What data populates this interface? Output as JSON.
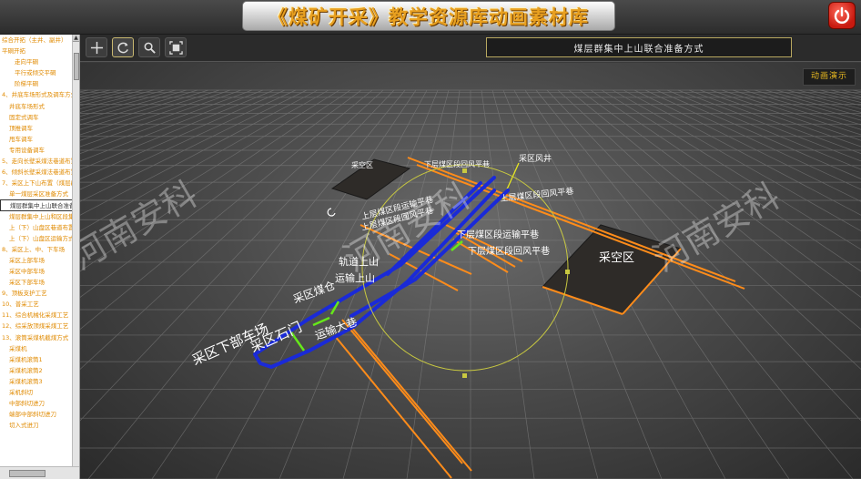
{
  "header": {
    "title": "《煤矿开采》教学资源库动画素材库"
  },
  "sidebar": {
    "items": [
      {
        "label": "综合开拓（主井、副井）",
        "level": 1
      },
      {
        "label": "平硐开拓",
        "level": 1
      },
      {
        "label": "走向平硐",
        "level": 3
      },
      {
        "label": "平行或倾交平硐",
        "level": 3
      },
      {
        "label": "阶梯平硐",
        "level": 3
      },
      {
        "label": "4、井底车场形式及调车方式",
        "level": 1
      },
      {
        "label": "井底车场形式",
        "level": 2
      },
      {
        "label": "固定式调车",
        "level": 2
      },
      {
        "label": "顶推调车",
        "level": 2
      },
      {
        "label": "甩车调车",
        "level": 2
      },
      {
        "label": "专用设备调车",
        "level": 2
      },
      {
        "label": "5、走向长壁采煤法巷道布置",
        "level": 1
      },
      {
        "label": "6、倾斜长壁采煤法巷道布置",
        "level": 1
      },
      {
        "label": "7、采区上下山布置（煤层群）",
        "level": 1
      },
      {
        "label": "单一煤层采区准备方式",
        "level": 2
      },
      {
        "label": "煤层群集中上山联合准备方式",
        "level": 2,
        "selected": true
      },
      {
        "label": "煤层群集中上山和区段集中平巷",
        "level": 2
      },
      {
        "label": "上（下）山盘区巷道布置",
        "level": 2
      },
      {
        "label": "上（下）山盘区运输方式",
        "level": 2
      },
      {
        "label": "8、采区上、中、下车场",
        "level": 1
      },
      {
        "label": "采区上部车场",
        "level": 2
      },
      {
        "label": "采区中部车场",
        "level": 2
      },
      {
        "label": "采区下部车场",
        "level": 2
      },
      {
        "label": "9、顶板支护工艺",
        "level": 1
      },
      {
        "label": "10、普采工艺",
        "level": 1
      },
      {
        "label": "11、综合机械化采煤工艺",
        "level": 1
      },
      {
        "label": "12、综采放顶煤采煤工艺",
        "level": 1
      },
      {
        "label": "13、滚筒采煤机截煤方式",
        "level": 1
      },
      {
        "label": "采煤机",
        "level": 2
      },
      {
        "label": "采煤机滚筒1",
        "level": 2
      },
      {
        "label": "采煤机滚筒2",
        "level": 2
      },
      {
        "label": "采煤机滚筒3",
        "level": 2
      },
      {
        "label": "采机斜切",
        "level": 2
      },
      {
        "label": "中部斜切进刀",
        "level": 2
      },
      {
        "label": "端部中部斜切进刀",
        "level": 2
      },
      {
        "label": "切入式进刀",
        "level": 2
      }
    ]
  },
  "toolbar": {
    "tools": [
      {
        "name": "move-tool",
        "icon": "crosshair-icon"
      },
      {
        "name": "rotate-tool",
        "icon": "rotate-icon",
        "active": true
      },
      {
        "name": "zoom-tool",
        "icon": "magnifier-icon"
      },
      {
        "name": "fit-tool",
        "icon": "fit-view-icon"
      }
    ],
    "scene_title": "煤层群集中上山联合准备方式"
  },
  "viewport": {
    "demo_label": "动画演示",
    "labels": {
      "goaf_left": "采空区",
      "goaf_right": "采空区",
      "vent_shaft": "采区风井",
      "upper_return": "上层煤区段回风平巷",
      "lower_return_top": "下层煤区段回风平巷",
      "upper_haul_1": "上层煤区段运输平巷",
      "upper_haul_2": "上层煤区段回风平巷",
      "lower_haul": "下层煤区段运输平巷",
      "lower_return": "下层煤区段回风平巷",
      "track_uphill": "轨道上山",
      "haul_uphill": "运输上山",
      "coal_bunker": "采区煤仓",
      "bottom_yard": "采区下部车场",
      "crosscut": "采区石门",
      "haul_roadway": "运输大巷",
      "watermark": "河南安科"
    },
    "colors": {
      "orange_roadway": "#ff8c1a",
      "blue_roadway": "#1a2ad8",
      "green_roadway": "#66e81a",
      "selection_circle": "#c8c840"
    }
  }
}
